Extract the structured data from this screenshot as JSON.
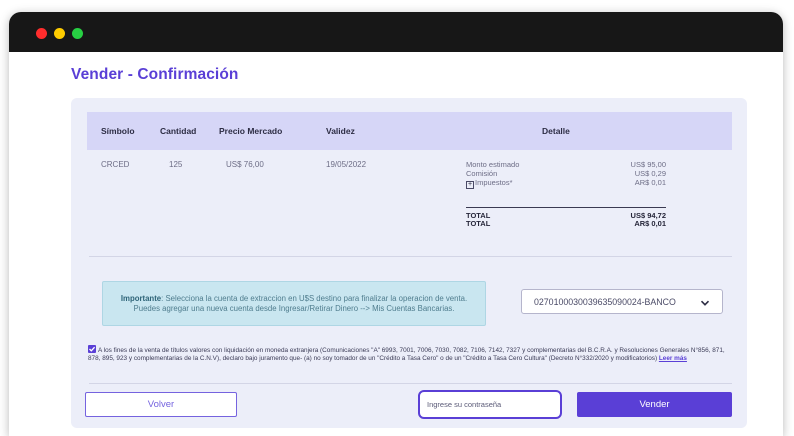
{
  "page": {
    "title": "Vender - Confirmación"
  },
  "table": {
    "headers": [
      "Símbolo",
      "Cantidad",
      "Precio Mercado",
      "Validez",
      "Detalle"
    ],
    "row": {
      "simbolo": "CRCED",
      "cantidad": "125",
      "precio": "US$ 76,00",
      "validez": "19/05/2022"
    }
  },
  "detalle": {
    "lines": [
      {
        "label": "Monto estimado",
        "value": "US$ 95,00"
      },
      {
        "label": "Comisión",
        "value": "US$ 0,29"
      },
      {
        "label": "Impuestos*",
        "value": "AR$ 0,01"
      }
    ],
    "totals": [
      {
        "label": "TOTAL",
        "value": "US$ 94,72"
      },
      {
        "label": "TOTAL",
        "value": "AR$ 0,01"
      }
    ],
    "expand_symbol": "+"
  },
  "notice": {
    "strong": "Importante",
    "line1": ": Selecciona la cuenta de extraccion en U$S destino para finalizar la operacion de venta.",
    "line2": "Puedes agregar una nueva cuenta desde Ingresar/Retirar Dinero --> Mis Cuentas Bancarias."
  },
  "account": {
    "selected": "0270100030039635090024-BANCO"
  },
  "terms": {
    "text": "A los fines de la venta de títulos valores con liquidación en moneda extranjera (Comunicaciones \"A\" 6993, 7001, 7006, 7030, 7082, 7106, 7142, 7327 y complementarias del B.C.R.A. y Resoluciones Generales N°856, 871, 878, 895, 923 y complementarias de la C.N.V), declaro bajo juramento que- (a) no soy tomador de un \"Crédito a Tasa Cero\" o de un \"Crédito a Tasa Cero Cultura\" (Decreto N°332/2020 y modificatorios)",
    "link": "Leer más"
  },
  "actions": {
    "back_label": "Volver",
    "password_placeholder": "Ingrese su contraseña",
    "sell_label": "Vender"
  },
  "colors": {
    "accent": "#5a3fd6",
    "table_header": "#d6d6f7",
    "panel": "#eceef9",
    "notice_bg": "#c9e6f0"
  },
  "icons": [
    "close-dot",
    "minimize-dot",
    "maximize-dot",
    "plus-icon",
    "chevron-down-icon",
    "checkbox-checked-icon"
  ]
}
